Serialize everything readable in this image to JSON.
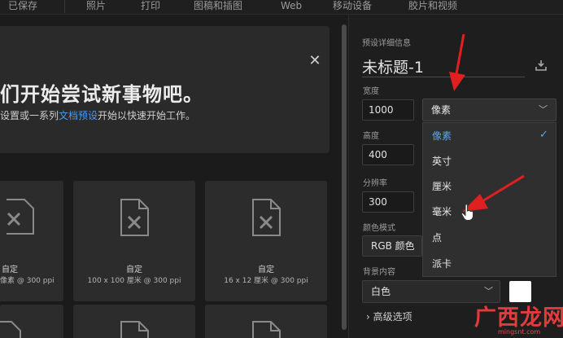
{
  "top_tabs": [
    "已保存",
    "照片",
    "打印",
    "图稿和插图",
    "Web",
    "移动设备",
    "胶片和视频"
  ],
  "welcome": {
    "title": "们开始尝试新事物吧。",
    "subtitle_pre": "设置或一系列",
    "subtitle_link": "文档预设",
    "subtitle_post": "开始以快速开始工作。"
  },
  "presets": [
    {
      "name": "自定",
      "size": "像素 @ 300 ppi"
    },
    {
      "name": "自定",
      "size": "100 x 100 厘米 @ 300 ppi"
    },
    {
      "name": "自定",
      "size": "16 x 12 厘米 @ 300 ppi"
    }
  ],
  "details": {
    "section_title": "预设详细信息",
    "doc_title": "未标题-1",
    "width_label": "宽度",
    "width_value": "1000",
    "height_label": "高度",
    "height_value": "400",
    "resolution_label": "分辨率",
    "resolution_value": "300",
    "color_mode_label": "颜色模式",
    "color_mode_value": "RGB 颜色",
    "background_label": "背景内容",
    "background_value": "白色",
    "advanced_label": "高级选项"
  },
  "units": {
    "selected": "像素",
    "options": [
      "像素",
      "英寸",
      "厘米",
      "毫米",
      "点",
      "派卡"
    ]
  },
  "icons": {
    "close": "close-icon",
    "save_preset": "save-preset-icon",
    "chevron": "chevron-down-icon",
    "check": "check-icon"
  },
  "colors": {
    "accent": "#4b9be8",
    "annotation": "#e02020",
    "background_swatch": "#ffffff"
  },
  "watermark": {
    "text": "广西龙网",
    "url": "mingsnt.com"
  }
}
